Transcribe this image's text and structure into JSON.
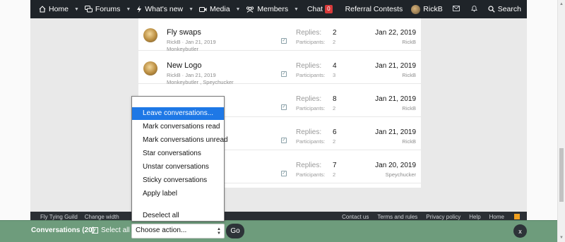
{
  "navbar": {
    "items": [
      {
        "label": "Home",
        "icon": "home-icon",
        "caret": true
      },
      {
        "label": "Forums",
        "icon": "chat-bubbles-icon",
        "caret": true
      },
      {
        "label": "What's new",
        "icon": "bolt-icon",
        "caret": true
      },
      {
        "label": "Media",
        "icon": "video-camera-icon",
        "caret": true
      },
      {
        "label": "Members",
        "icon": "members-icon",
        "caret": true
      },
      {
        "label": "Chat",
        "badge": "0",
        "caret": false
      },
      {
        "label": "Referral Contests",
        "caret": false
      }
    ],
    "user": "RickB",
    "search_label": "Search"
  },
  "conversations": [
    {
      "title": "Fly swaps",
      "meta": "RickB · Jan 21, 2019",
      "participants": "Monkeybutler",
      "replies_label": "Replies:",
      "replies": "2",
      "participants_label": "Participants:",
      "participants_count": "2",
      "date": "Jan 22, 2019",
      "last_user": "RickB"
    },
    {
      "title": "New Logo",
      "meta": "RickB · Jan 21, 2019",
      "participants": "Monkeybutler , Speychucker",
      "replies_label": "Replies:",
      "replies": "4",
      "participants_label": "Participants:",
      "participants_count": "3",
      "date": "Jan 21, 2019",
      "last_user": "RickB"
    },
    {
      "title": "",
      "meta": "",
      "participants": "",
      "replies_label": "Replies:",
      "replies": "8",
      "participants_label": "Participants:",
      "participants_count": "2",
      "date": "Jan 21, 2019",
      "last_user": "RickB"
    },
    {
      "title": "",
      "meta": "",
      "participants": "",
      "replies_label": "Replies:",
      "replies": "6",
      "participants_label": "Participants:",
      "participants_count": "2",
      "date": "Jan 21, 2019",
      "last_user": "RickB"
    },
    {
      "title": "",
      "meta": "",
      "participants": "",
      "replies_label": "Replies:",
      "replies": "7",
      "participants_label": "Participants:",
      "participants_count": "2",
      "date": "Jan 20, 2019",
      "last_user": "Speychucker"
    }
  ],
  "footer": {
    "left": [
      "Fly Tying Guild",
      "Change width"
    ],
    "right": [
      "Contact us",
      "Terms and rules",
      "Privacy policy",
      "Help",
      "Home"
    ]
  },
  "dropdown": {
    "items": [
      "Leave conversations...",
      "Mark conversations read",
      "Mark conversations unread",
      "Star conversations",
      "Unstar conversations",
      "Sticky conversations",
      "Apply label",
      "Deselect all"
    ],
    "active_index": 0
  },
  "action_bar": {
    "count_label": "Conversations (20)",
    "select_all_label": "Select all",
    "select_placeholder": "Choose action...",
    "go_label": "Go",
    "close_label": "x"
  },
  "colors": {
    "navbar": "#1f2429",
    "action_bar": "#6e9c7c",
    "highlight": "#1e78e6",
    "badge": "#d93a3a"
  }
}
